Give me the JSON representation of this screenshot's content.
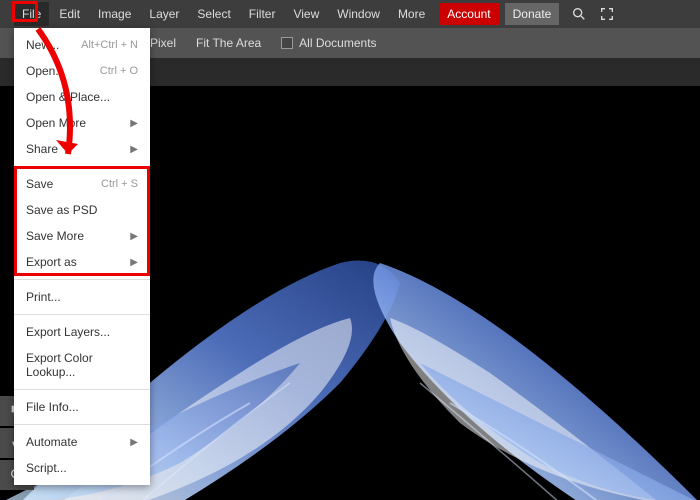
{
  "menubar": {
    "items": [
      "File",
      "Edit",
      "Image",
      "Layer",
      "Select",
      "Filter",
      "View",
      "Window",
      "More"
    ],
    "account": "Account",
    "donate": "Donate"
  },
  "toolbar": {
    "pixel_label": "Pixel",
    "fit_label": "Fit The Area",
    "all_docs_label": "All Documents"
  },
  "dropdown": {
    "items": [
      {
        "label": "New...",
        "shortcut": "Alt+Ctrl + N"
      },
      {
        "label": "Open...",
        "shortcut": "Ctrl + O"
      },
      {
        "label": "Open & Place..."
      },
      {
        "label": "Open More",
        "chevron": true
      },
      {
        "label": "Share",
        "chevron": true
      },
      {
        "sep": true
      },
      {
        "label": "Save",
        "shortcut": "Ctrl + S"
      },
      {
        "label": "Save as PSD"
      },
      {
        "label": "Save More",
        "chevron": true
      },
      {
        "label": "Export as",
        "chevron": true
      },
      {
        "sep": true
      },
      {
        "label": "Print..."
      },
      {
        "sep": true
      },
      {
        "label": "Export Layers..."
      },
      {
        "label": "Export Color Lookup..."
      },
      {
        "sep": true
      },
      {
        "label": "File Info..."
      },
      {
        "sep": true
      },
      {
        "label": "Automate",
        "chevron": true
      },
      {
        "label": "Script..."
      }
    ]
  },
  "colors": {
    "accent_red": "#e00000",
    "menu_active": "#c00000"
  }
}
